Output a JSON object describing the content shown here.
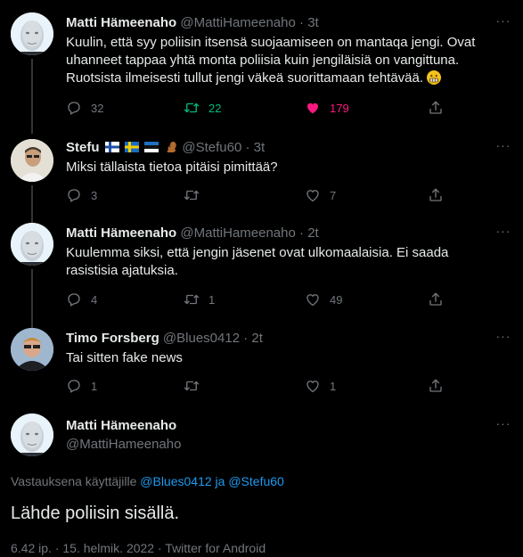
{
  "tweets": [
    {
      "name": "Matti Hämeenaho",
      "handle": "@MattiHameenaho",
      "time": "3t",
      "text": "Kuulin, että syy poliisin itsensä suojaamiseen on mantaqa jengi. Ovat uhanneet tappaa yhtä monta poliisia kuin jengiläisiä on vangittuna. Ruotsista ilmeisesti tullut jengi väkeä suorittamaan tehtävää.",
      "reply_count": "32",
      "retweet_count": "22",
      "like_count": "179"
    },
    {
      "name": "Stefu",
      "handle": "@Stefu60",
      "time": "3t",
      "text": "Miksi tällaista tietoa pitäisi pimittää?",
      "reply_count": "3",
      "retweet_count": "",
      "like_count": "7"
    },
    {
      "name": "Matti Hämeenaho",
      "handle": "@MattiHameenaho",
      "time": "2t",
      "text": "Kuulemma siksi, että jengin jäsenet ovat ulkomaalaisia. Ei saada rasistisia ajatuksia.",
      "reply_count": "4",
      "retweet_count": "1",
      "like_count": "49"
    },
    {
      "name": "Timo Forsberg",
      "handle": "@Blues0412",
      "time": "2t",
      "text": "Tai sitten fake news",
      "reply_count": "1",
      "retweet_count": "",
      "like_count": "1"
    }
  ],
  "main_tweet": {
    "name": "Matti Hämeenaho",
    "handle": "@MattiHameenaho",
    "reply_prefix": "Vastauksena käyttäjille",
    "reply_user1": "@Blues0412",
    "reply_joiner": "ja",
    "reply_user2": "@Stefu60",
    "text": "Lähde poliisin sisällä.",
    "meta": "6.42 ip. · 15. helmik. 2022 · Twitter for Android"
  },
  "colors": {
    "background": "#000000",
    "text": "#e7e9ea",
    "muted": "#71767b",
    "link": "#1d9bf0",
    "retweet_active": "#00ba7c",
    "like_active": "#f91880"
  },
  "icons": [
    "more-icon",
    "reply-icon",
    "retweet-icon",
    "like-icon",
    "share-icon",
    "grimace-emoji",
    "finland-flag",
    "sweden-flag",
    "estonia-flag",
    "squirrel-emoji"
  ]
}
